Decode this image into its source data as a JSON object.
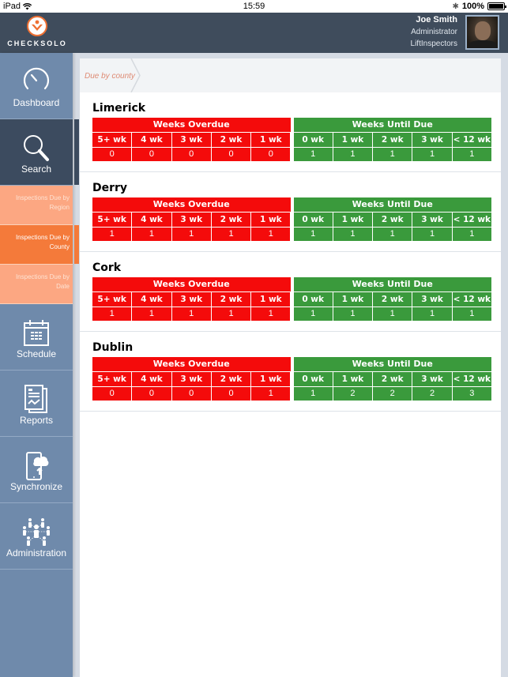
{
  "status_bar": {
    "device": "iPad",
    "time": "15:59",
    "battery": "100%",
    "battery_level": 1.0
  },
  "header": {
    "brand": "CHECKSOLO",
    "user": {
      "name": "Joe Smith",
      "role": "Administrator",
      "organization": "LiftInspectors"
    }
  },
  "sidebar": {
    "items": [
      {
        "label": "Dashboard",
        "icon": "speedometer-icon"
      },
      {
        "label": "Search",
        "icon": "search-icon",
        "active": true
      },
      {
        "label": "Schedule",
        "icon": "calendar-icon"
      },
      {
        "label": "Reports",
        "icon": "reports-icon"
      },
      {
        "label": "Synchronize",
        "icon": "sync-cloud-icon"
      },
      {
        "label": "Administration",
        "icon": "people-network-icon"
      }
    ],
    "search_subitems": [
      {
        "label": "Inspections Due by Region"
      },
      {
        "label": "Inspections Due by County",
        "selected": true
      },
      {
        "label": "Inspections Due by Date"
      }
    ]
  },
  "breadcrumb": {
    "current": "Due by county"
  },
  "tables_meta": {
    "overdue_title": "Weeks Overdue",
    "until_due_title": "Weeks Until Due",
    "overdue_columns": [
      "5+ wk",
      "4 wk",
      "3 wk",
      "2 wk",
      "1 wk"
    ],
    "until_due_columns": [
      "0 wk",
      "1 wk",
      "2 wk",
      "3 wk",
      "< 12 wk"
    ],
    "overdue_color": "#f40b0b",
    "until_due_color": "#3a9a3c"
  },
  "counties": [
    {
      "name": "Limerick",
      "overdue": [
        "0",
        "0",
        "0",
        "0",
        "0"
      ],
      "until_due": [
        "1",
        "1",
        "1",
        "1",
        "1"
      ]
    },
    {
      "name": "Derry",
      "overdue": [
        "1",
        "1",
        "1",
        "1",
        "1"
      ],
      "until_due": [
        "1",
        "1",
        "1",
        "1",
        "1"
      ]
    },
    {
      "name": "Cork",
      "overdue": [
        "1",
        "1",
        "1",
        "1",
        "1"
      ],
      "until_due": [
        "1",
        "1",
        "1",
        "1",
        "1"
      ]
    },
    {
      "name": "Dublin",
      "overdue": [
        "0",
        "0",
        "0",
        "0",
        "1"
      ],
      "until_due": [
        "1",
        "2",
        "2",
        "2",
        "3"
      ]
    }
  ]
}
